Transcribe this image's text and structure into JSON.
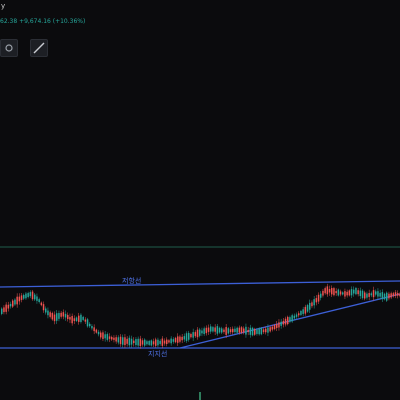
{
  "header": {
    "ticker_text": "у",
    "price_change_text": "62.38  +9,674.16  (+10.36%)"
  },
  "toolbar": {
    "tools": [
      {
        "name": "settings-tool",
        "icon": "gear-icon"
      },
      {
        "name": "draw-tool",
        "icon": "line-tool-icon"
      }
    ]
  },
  "annotations": {
    "resistance_label": "저항선",
    "support_label": "지지선"
  },
  "colors": {
    "background": "#0b0b0d",
    "up": "#26a69a",
    "down": "#ef5350",
    "trendline": "#3c5fd6",
    "divider": "#1f5e4a"
  }
}
